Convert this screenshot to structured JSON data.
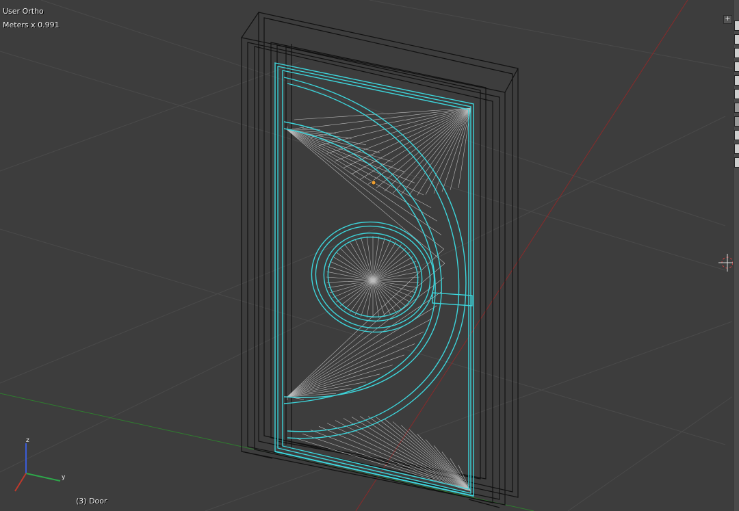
{
  "viewport": {
    "view_label": "User Ortho",
    "units_label": "Meters x 0.991",
    "object_label": "(3) Door"
  },
  "axis_gizmo": {
    "z_label": "z",
    "y_label": "y"
  },
  "colors": {
    "background": "#3d3d3d",
    "grid": "#4a4a4a",
    "selection_outline": "#3dd6dc",
    "wireframe": "#111111",
    "mesh_triangles": "#bdbdbd",
    "x_axis_line": "#8a2a2a",
    "y_axis_line": "#2f7d2f",
    "origin_dot": "#f0a030"
  },
  "icons": [
    "axis-gizmo-icon",
    "3d-cursor-icon",
    "plus-icon",
    "layer-toggle-icon"
  ]
}
